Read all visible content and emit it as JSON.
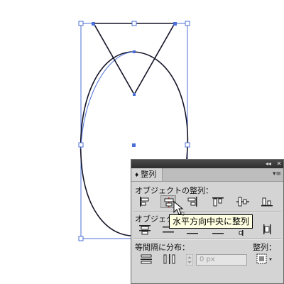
{
  "panel": {
    "tab_label": "整列",
    "collapse_glyph": "◂◂",
    "close_glyph": "✕",
    "menu_glyph": "▾≡"
  },
  "sections": {
    "align_objects": "オブジェクトの整列：",
    "distribute_objects_partial": "オブジェクト",
    "distribute_spacing": "等間隔に分布：",
    "align_to": "整列："
  },
  "spacing_field": {
    "value": "0 px"
  },
  "tooltip": {
    "text": "水平方向中央に整列"
  },
  "colors": {
    "selection": "#4b6fd6",
    "panel_bg": "#d4d4d4",
    "tooltip_bg": "#ffffe1"
  },
  "icons": {
    "align_buttons": [
      "align-left-icon",
      "align-horizontal-center-icon",
      "align-right-icon",
      "align-top-icon",
      "align-vertical-center-icon",
      "align-bottom-icon"
    ],
    "distribute_buttons": [
      "distribute-top-icon",
      "distribute-vertical-center-icon",
      "distribute-bottom-icon",
      "distribute-left-icon",
      "distribute-horizontal-center-icon",
      "distribute-right-icon"
    ],
    "spacing_buttons": [
      "distribute-vertical-space-icon",
      "distribute-horizontal-space-icon"
    ],
    "align_to_button": "align-to-selection-icon"
  }
}
